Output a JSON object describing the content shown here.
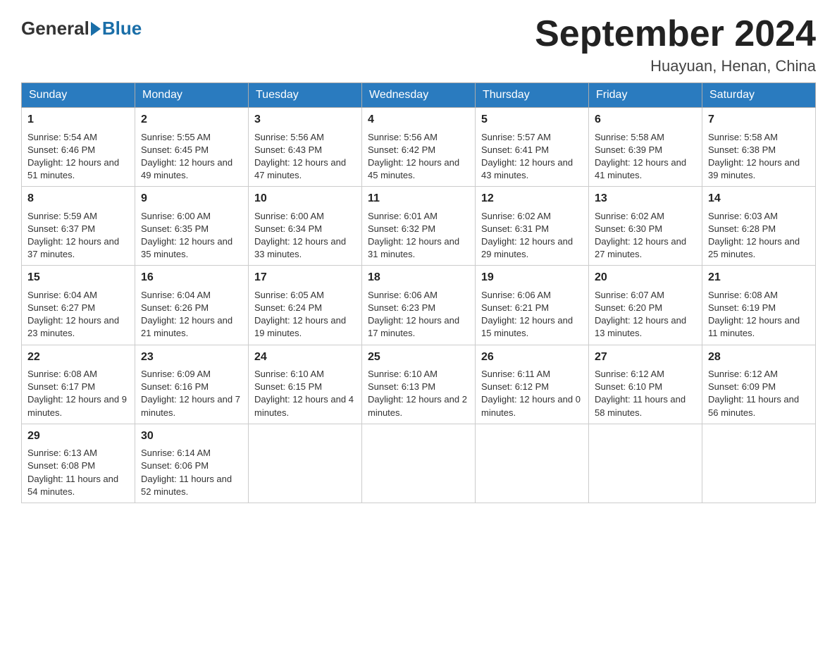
{
  "header": {
    "logo_general": "General",
    "logo_blue": "Blue",
    "month_title": "September 2024",
    "subtitle": "Huayuan, Henan, China"
  },
  "days_of_week": [
    "Sunday",
    "Monday",
    "Tuesday",
    "Wednesday",
    "Thursday",
    "Friday",
    "Saturday"
  ],
  "weeks": [
    [
      {
        "day": "1",
        "sunrise": "5:54 AM",
        "sunset": "6:46 PM",
        "daylight": "12 hours and 51 minutes."
      },
      {
        "day": "2",
        "sunrise": "5:55 AM",
        "sunset": "6:45 PM",
        "daylight": "12 hours and 49 minutes."
      },
      {
        "day": "3",
        "sunrise": "5:56 AM",
        "sunset": "6:43 PM",
        "daylight": "12 hours and 47 minutes."
      },
      {
        "day": "4",
        "sunrise": "5:56 AM",
        "sunset": "6:42 PM",
        "daylight": "12 hours and 45 minutes."
      },
      {
        "day": "5",
        "sunrise": "5:57 AM",
        "sunset": "6:41 PM",
        "daylight": "12 hours and 43 minutes."
      },
      {
        "day": "6",
        "sunrise": "5:58 AM",
        "sunset": "6:39 PM",
        "daylight": "12 hours and 41 minutes."
      },
      {
        "day": "7",
        "sunrise": "5:58 AM",
        "sunset": "6:38 PM",
        "daylight": "12 hours and 39 minutes."
      }
    ],
    [
      {
        "day": "8",
        "sunrise": "5:59 AM",
        "sunset": "6:37 PM",
        "daylight": "12 hours and 37 minutes."
      },
      {
        "day": "9",
        "sunrise": "6:00 AM",
        "sunset": "6:35 PM",
        "daylight": "12 hours and 35 minutes."
      },
      {
        "day": "10",
        "sunrise": "6:00 AM",
        "sunset": "6:34 PM",
        "daylight": "12 hours and 33 minutes."
      },
      {
        "day": "11",
        "sunrise": "6:01 AM",
        "sunset": "6:32 PM",
        "daylight": "12 hours and 31 minutes."
      },
      {
        "day": "12",
        "sunrise": "6:02 AM",
        "sunset": "6:31 PM",
        "daylight": "12 hours and 29 minutes."
      },
      {
        "day": "13",
        "sunrise": "6:02 AM",
        "sunset": "6:30 PM",
        "daylight": "12 hours and 27 minutes."
      },
      {
        "day": "14",
        "sunrise": "6:03 AM",
        "sunset": "6:28 PM",
        "daylight": "12 hours and 25 minutes."
      }
    ],
    [
      {
        "day": "15",
        "sunrise": "6:04 AM",
        "sunset": "6:27 PM",
        "daylight": "12 hours and 23 minutes."
      },
      {
        "day": "16",
        "sunrise": "6:04 AM",
        "sunset": "6:26 PM",
        "daylight": "12 hours and 21 minutes."
      },
      {
        "day": "17",
        "sunrise": "6:05 AM",
        "sunset": "6:24 PM",
        "daylight": "12 hours and 19 minutes."
      },
      {
        "day": "18",
        "sunrise": "6:06 AM",
        "sunset": "6:23 PM",
        "daylight": "12 hours and 17 minutes."
      },
      {
        "day": "19",
        "sunrise": "6:06 AM",
        "sunset": "6:21 PM",
        "daylight": "12 hours and 15 minutes."
      },
      {
        "day": "20",
        "sunrise": "6:07 AM",
        "sunset": "6:20 PM",
        "daylight": "12 hours and 13 minutes."
      },
      {
        "day": "21",
        "sunrise": "6:08 AM",
        "sunset": "6:19 PM",
        "daylight": "12 hours and 11 minutes."
      }
    ],
    [
      {
        "day": "22",
        "sunrise": "6:08 AM",
        "sunset": "6:17 PM",
        "daylight": "12 hours and 9 minutes."
      },
      {
        "day": "23",
        "sunrise": "6:09 AM",
        "sunset": "6:16 PM",
        "daylight": "12 hours and 7 minutes."
      },
      {
        "day": "24",
        "sunrise": "6:10 AM",
        "sunset": "6:15 PM",
        "daylight": "12 hours and 4 minutes."
      },
      {
        "day": "25",
        "sunrise": "6:10 AM",
        "sunset": "6:13 PM",
        "daylight": "12 hours and 2 minutes."
      },
      {
        "day": "26",
        "sunrise": "6:11 AM",
        "sunset": "6:12 PM",
        "daylight": "12 hours and 0 minutes."
      },
      {
        "day": "27",
        "sunrise": "6:12 AM",
        "sunset": "6:10 PM",
        "daylight": "11 hours and 58 minutes."
      },
      {
        "day": "28",
        "sunrise": "6:12 AM",
        "sunset": "6:09 PM",
        "daylight": "11 hours and 56 minutes."
      }
    ],
    [
      {
        "day": "29",
        "sunrise": "6:13 AM",
        "sunset": "6:08 PM",
        "daylight": "11 hours and 54 minutes."
      },
      {
        "day": "30",
        "sunrise": "6:14 AM",
        "sunset": "6:06 PM",
        "daylight": "11 hours and 52 minutes."
      },
      null,
      null,
      null,
      null,
      null
    ]
  ]
}
